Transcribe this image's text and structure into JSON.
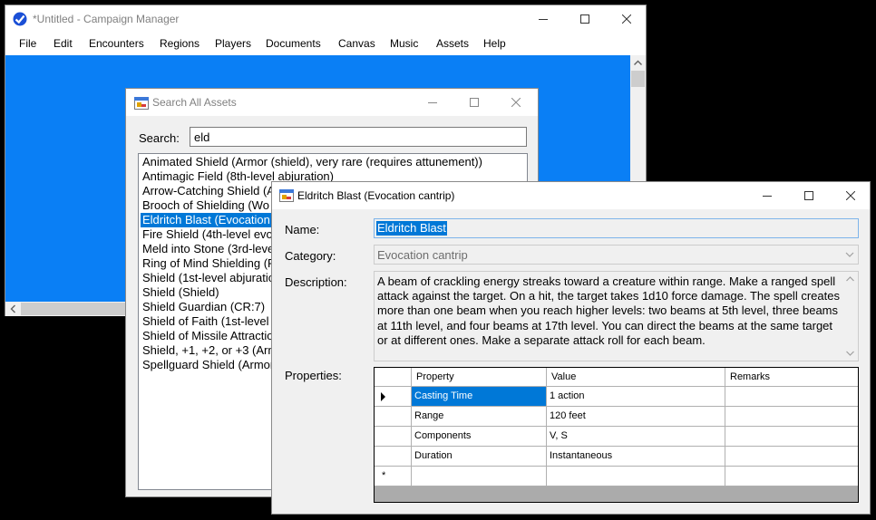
{
  "main_window": {
    "title": "*Untitled - Campaign Manager",
    "menu": [
      "File",
      "Edit",
      "Encounters",
      "Regions",
      "Players",
      "Documents",
      "Canvas",
      "Music",
      "Assets",
      "Help"
    ],
    "canvas_color": "#0a7ff5"
  },
  "search_window": {
    "title": "Search All Assets",
    "search_label": "Search:",
    "search_value": "eld",
    "results": [
      "Animated Shield (Armor (shield), very rare (requires attunement))",
      "Antimagic Field (8th-level abjuration)",
      "Arrow-Catching Shield (A",
      "Brooch of Shielding (Wo",
      "Eldritch Blast (Evocation",
      "Fire Shield (4th-level evo",
      "Meld into Stone (3rd-leve",
      "Ring of Mind Shielding (R",
      "Shield (1st-level abjuratio",
      "Shield (Shield)",
      "Shield Guardian (CR:7)",
      "Shield of Faith (1st-level",
      "Shield of Missile Attractio",
      "Shield, +1, +2, or +3 (Arm",
      "Spellguard Shield (Armor"
    ],
    "selected_index": 4
  },
  "detail_window": {
    "title": "Eldritch Blast (Evocation cantrip)",
    "name_label": "Name:",
    "name_value": "Eldritch Blast",
    "category_label": "Category:",
    "category_value": "Evocation cantrip",
    "description_label": "Description:",
    "description_value": "A beam of crackling energy streaks toward a creature within range. Make a ranged spell attack against the target. On a hit, the target takes 1d10 force damage. The spell creates more than one beam when you reach higher levels: two beams at 5th level, three beams at 11th level, and four beams at 17th level. You can direct the beams at the same target or at different ones. Make a separate attack roll for each beam.",
    "properties_label": "Properties:",
    "grid": {
      "columns": [
        "Property",
        "Value",
        "Remarks"
      ],
      "rows": [
        [
          "Casting Time",
          "1 action",
          ""
        ],
        [
          "Range",
          "120 feet",
          ""
        ],
        [
          "Components",
          "V, S",
          ""
        ],
        [
          "Duration",
          "Instantaneous",
          ""
        ]
      ],
      "new_row_marker": "*"
    }
  },
  "colors": {
    "selection": "#0078d7",
    "window_bg": "#f0f0f0"
  }
}
